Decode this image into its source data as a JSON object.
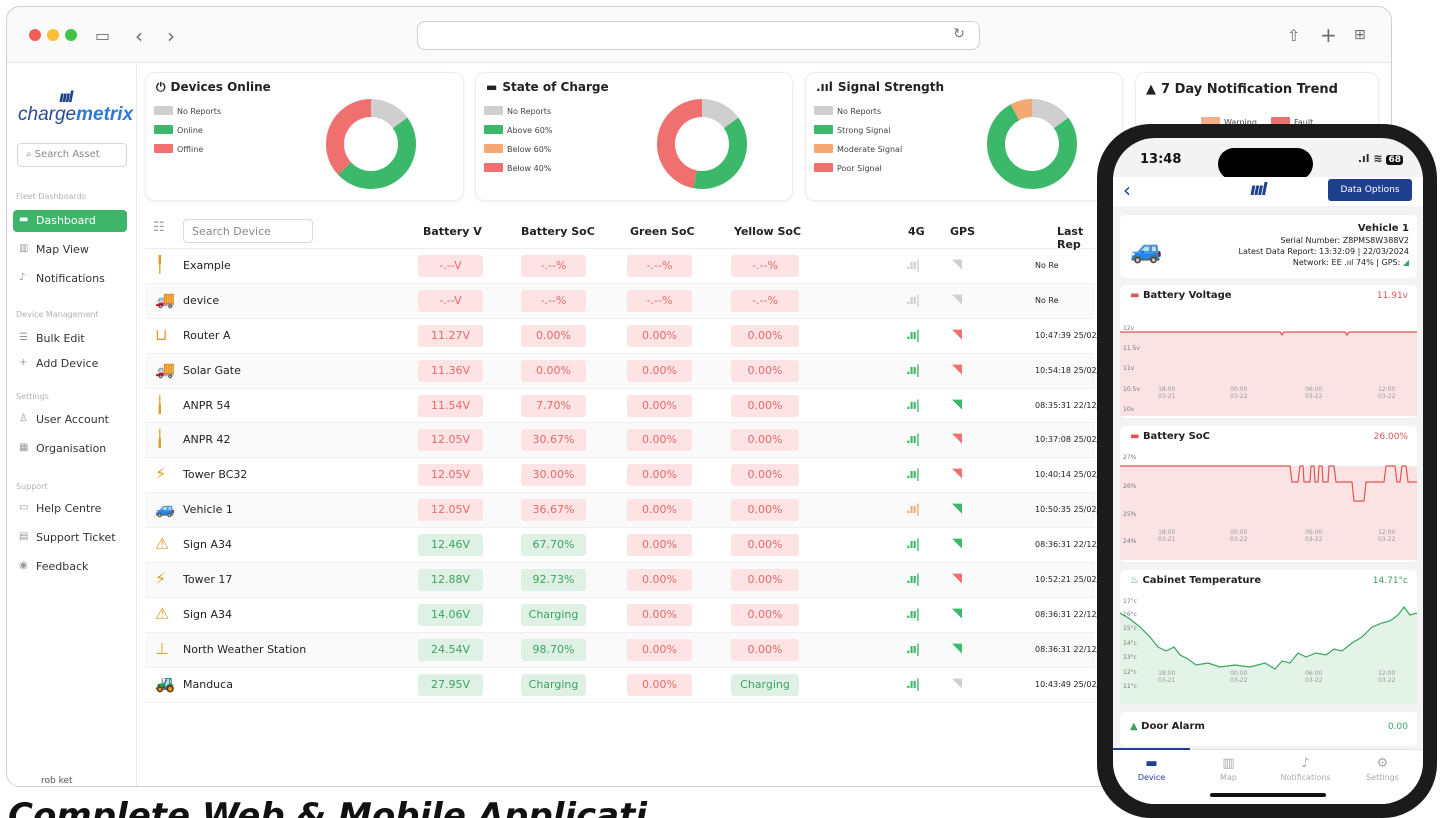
{
  "browser": {
    "reload_icon": "reload-icon"
  },
  "sidebar": {
    "logo": {
      "bars": "ıııl",
      "charge": "charge",
      "metrix": "metrix"
    },
    "search_placeholder": "Search Asset",
    "section_fleet": "Fleet Dashboards",
    "section_device": "Device Management",
    "section_settings": "Settings",
    "section_support": "Support",
    "items": [
      {
        "label": "Dashboard"
      },
      {
        "label": "Map View"
      },
      {
        "label": "Notifications"
      },
      {
        "label": "Bulk Edit"
      },
      {
        "label": "Add Device"
      },
      {
        "label": "User Account"
      },
      {
        "label": "Organisation"
      },
      {
        "label": "Help Centre"
      },
      {
        "label": "Support Ticket"
      },
      {
        "label": "Feedback"
      }
    ],
    "user": "rob ket"
  },
  "cards": {
    "devices_online": {
      "title": "Devices Online",
      "legend": [
        "No Reports",
        "Online",
        "Offline"
      ],
      "values": [
        0.15,
        0.48,
        0.37
      ]
    },
    "state_of_charge": {
      "title": "State of Charge",
      "legend": [
        "No Reports",
        "Above 60%",
        "Below 60%",
        "Below 40%"
      ],
      "values": [
        0.15,
        0.38,
        0.0,
        0.47
      ]
    },
    "signal_strength": {
      "title": "Signal Strength",
      "legend": [
        "No Reports",
        "Strong Signal",
        "Moderate Signal",
        "Poor Signal"
      ],
      "values": [
        0.15,
        0.77,
        0.08,
        0.0
      ]
    },
    "trend": {
      "title": "7 Day Notification Trend",
      "legend": [
        "Warning",
        "Fault"
      ]
    }
  },
  "colors": {
    "green": "#3cb86a",
    "red": "#f07070",
    "grey": "#cfcfcf",
    "orange": "#f5a872",
    "navy": "#1f3f8f"
  },
  "table": {
    "search_placeholder": "Search Device",
    "headers": {
      "battery_v": "Battery V",
      "battery_soc": "Battery SoC",
      "green_soc": "Green SoC",
      "yellow_soc": "Yellow SoC",
      "g4": "4G",
      "gps": "GPS",
      "last": "Last Rep"
    },
    "rows": [
      {
        "icon": "╿",
        "name": "Example",
        "v": "-.--V",
        "soc": "-.--%",
        "green": "-.--%",
        "yellow": "-.--%",
        "vc": "r",
        "sc": "r",
        "sig": "grey",
        "gps": "grey",
        "last": "No Re"
      },
      {
        "icon": "🚚",
        "name": "device",
        "v": "-.--V",
        "soc": "-.--%",
        "green": "-.--%",
        "yellow": "-.--%",
        "vc": "r",
        "sc": "r",
        "sig": "grey",
        "gps": "grey",
        "last": "No Re"
      },
      {
        "icon": "⊔",
        "name": "Router A",
        "v": "11.27V",
        "soc": "0.00%",
        "green": "0.00%",
        "yellow": "0.00%",
        "vc": "r",
        "sc": "r",
        "sig": "green",
        "gps": "red",
        "last": "10:47:39 25/02/"
      },
      {
        "icon": "🚚",
        "name": "Solar Gate",
        "v": "11.36V",
        "soc": "0.00%",
        "green": "0.00%",
        "yellow": "0.00%",
        "vc": "r",
        "sc": "r",
        "sig": "green",
        "gps": "red",
        "last": "10:54:18 25/02/"
      },
      {
        "icon": "╽",
        "name": "ANPR 54",
        "v": "11.54V",
        "soc": "7.70%",
        "green": "0.00%",
        "yellow": "0.00%",
        "vc": "r",
        "sc": "r",
        "sig": "green",
        "gps": "green",
        "last": "08:35:31 22/12/"
      },
      {
        "icon": "╽",
        "name": "ANPR 42",
        "v": "12.05V",
        "soc": "30.67%",
        "green": "0.00%",
        "yellow": "0.00%",
        "vc": "r",
        "sc": "r",
        "sig": "green",
        "gps": "red",
        "last": "10:37:08 25/02/"
      },
      {
        "icon": "⚡",
        "name": "Tower BC32",
        "v": "12.05V",
        "soc": "30.00%",
        "green": "0.00%",
        "yellow": "0.00%",
        "vc": "r",
        "sc": "r",
        "sig": "green",
        "gps": "red",
        "last": "10:40:14 25/02/"
      },
      {
        "icon": "🚙",
        "name": "Vehicle 1",
        "v": "12.05V",
        "soc": "36.67%",
        "green": "0.00%",
        "yellow": "0.00%",
        "vc": "r",
        "sc": "r",
        "sig": "orange",
        "gps": "green",
        "last": "10:50:35 25/02/"
      },
      {
        "icon": "⚠",
        "name": "Sign A34",
        "v": "12.46V",
        "soc": "67.70%",
        "green": "0.00%",
        "yellow": "0.00%",
        "vc": "g",
        "sc": "g",
        "sig": "green",
        "gps": "green",
        "last": "08:36:31 22/12/"
      },
      {
        "icon": "⚡",
        "name": "Tower 17",
        "v": "12.88V",
        "soc": "92.73%",
        "green": "0.00%",
        "yellow": "0.00%",
        "vc": "g",
        "sc": "g",
        "sig": "green",
        "gps": "red",
        "last": "10:52:21 25/02/"
      },
      {
        "icon": "⚠",
        "name": "Sign A34",
        "v": "14.06V",
        "soc": "Charging",
        "green": "0.00%",
        "yellow": "0.00%",
        "vc": "g",
        "sc": "g",
        "sig": "green",
        "gps": "green",
        "last": "08:36:31 22/12/"
      },
      {
        "icon": "⊥",
        "name": "North Weather Station",
        "v": "24.54V",
        "soc": "98.70%",
        "green": "0.00%",
        "yellow": "0.00%",
        "vc": "g",
        "sc": "g",
        "sig": "green",
        "gps": "green",
        "last": "08:36:31 22/12/"
      },
      {
        "icon": "🚜",
        "name": "Manduca",
        "v": "27.95V",
        "soc": "Charging",
        "green": "0.00%",
        "yellow": "Charging",
        "vc": "g",
        "sc": "g",
        "yc": "g",
        "sig": "green",
        "gps": "grey",
        "last": "10:43:49 25/02/"
      }
    ]
  },
  "headline": "Complete Web & Mobile Applicati",
  "phone": {
    "time": "13:48",
    "battery": "68",
    "data_options": "Data Options",
    "vehicle": {
      "name": "Vehicle 1",
      "serial": "Serial Number: Z8PMS8W388V2",
      "latest": "Latest Data Report: 13:32:09 | 22/03/2024",
      "network": "Network: EE .ııl 74% | GPS:"
    },
    "charts": [
      {
        "title": "Battery Voltage",
        "value": "11.91v",
        "value_color": "#e05555",
        "ylabels": [
          "12v",
          "11.5v",
          "11v",
          "10.5v",
          "10v"
        ],
        "xlabels": [
          [
            "18:00",
            "03-21"
          ],
          [
            "00:00",
            "03-22"
          ],
          [
            "06:00",
            "03-22"
          ],
          [
            "12:00",
            "03-22"
          ]
        ]
      },
      {
        "title": "Battery SoC",
        "value": "26.00%",
        "value_color": "#e05555",
        "ylabels": [
          "27%",
          "26%",
          "25%",
          "24%"
        ],
        "xlabels": [
          [
            "18:00",
            "03-21"
          ],
          [
            "00:00",
            "03-22"
          ],
          [
            "06:00",
            "03-22"
          ],
          [
            "12:00",
            "03-22"
          ]
        ]
      },
      {
        "title": "Cabinet Temperature",
        "value": "14.71°c",
        "value_color": "#3aa45e",
        "ylabels": [
          "17°c",
          "16°c",
          "15°c",
          "14°c",
          "13°c",
          "12°c",
          "11°c"
        ],
        "xlabels": [
          [
            "18:00",
            "03-21"
          ],
          [
            "00:00",
            "03-22"
          ],
          [
            "06:00",
            "03-22"
          ],
          [
            "12:00",
            "03-22"
          ]
        ]
      },
      {
        "title": "Door Alarm",
        "value": "0.00",
        "value_color": "#3aa45e"
      }
    ],
    "tabs": [
      {
        "label": "Device"
      },
      {
        "label": "Map"
      },
      {
        "label": "Notifications"
      },
      {
        "label": "Settings"
      }
    ]
  }
}
